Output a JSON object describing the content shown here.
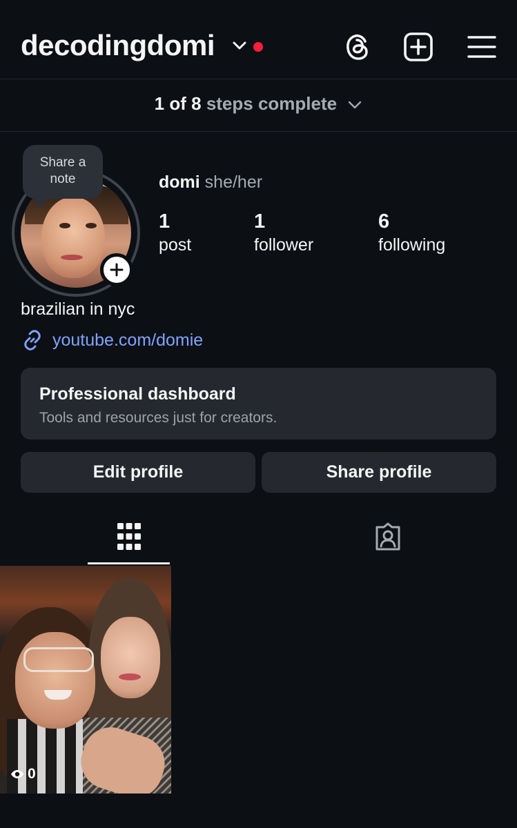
{
  "header": {
    "username": "decodingdomi",
    "icons": [
      "chevron-down-icon",
      "threads-icon",
      "new-post-icon",
      "menu-icon"
    ]
  },
  "steps": {
    "done": "1 of 8",
    "rest": "steps complete"
  },
  "note": {
    "label_line1": "Share a",
    "label_line2": "note"
  },
  "profile": {
    "name": "domi",
    "pronouns": "she/her",
    "stats": [
      {
        "num": "1",
        "label": "post"
      },
      {
        "num": "1",
        "label": "follower"
      },
      {
        "num": "6",
        "label": "following"
      }
    ],
    "bio": "brazilian in nyc",
    "link": "youtube.com/domie"
  },
  "dashboard": {
    "title": "Professional dashboard",
    "subtitle": "Tools and resources just for creators."
  },
  "buttons": {
    "edit": "Edit profile",
    "share": "Share profile"
  },
  "post": {
    "views": "0"
  },
  "colors": {
    "background": "#0c0f14",
    "card": "#25292f",
    "link": "#7fa4ff",
    "red_dot": "#ff1f3d"
  }
}
